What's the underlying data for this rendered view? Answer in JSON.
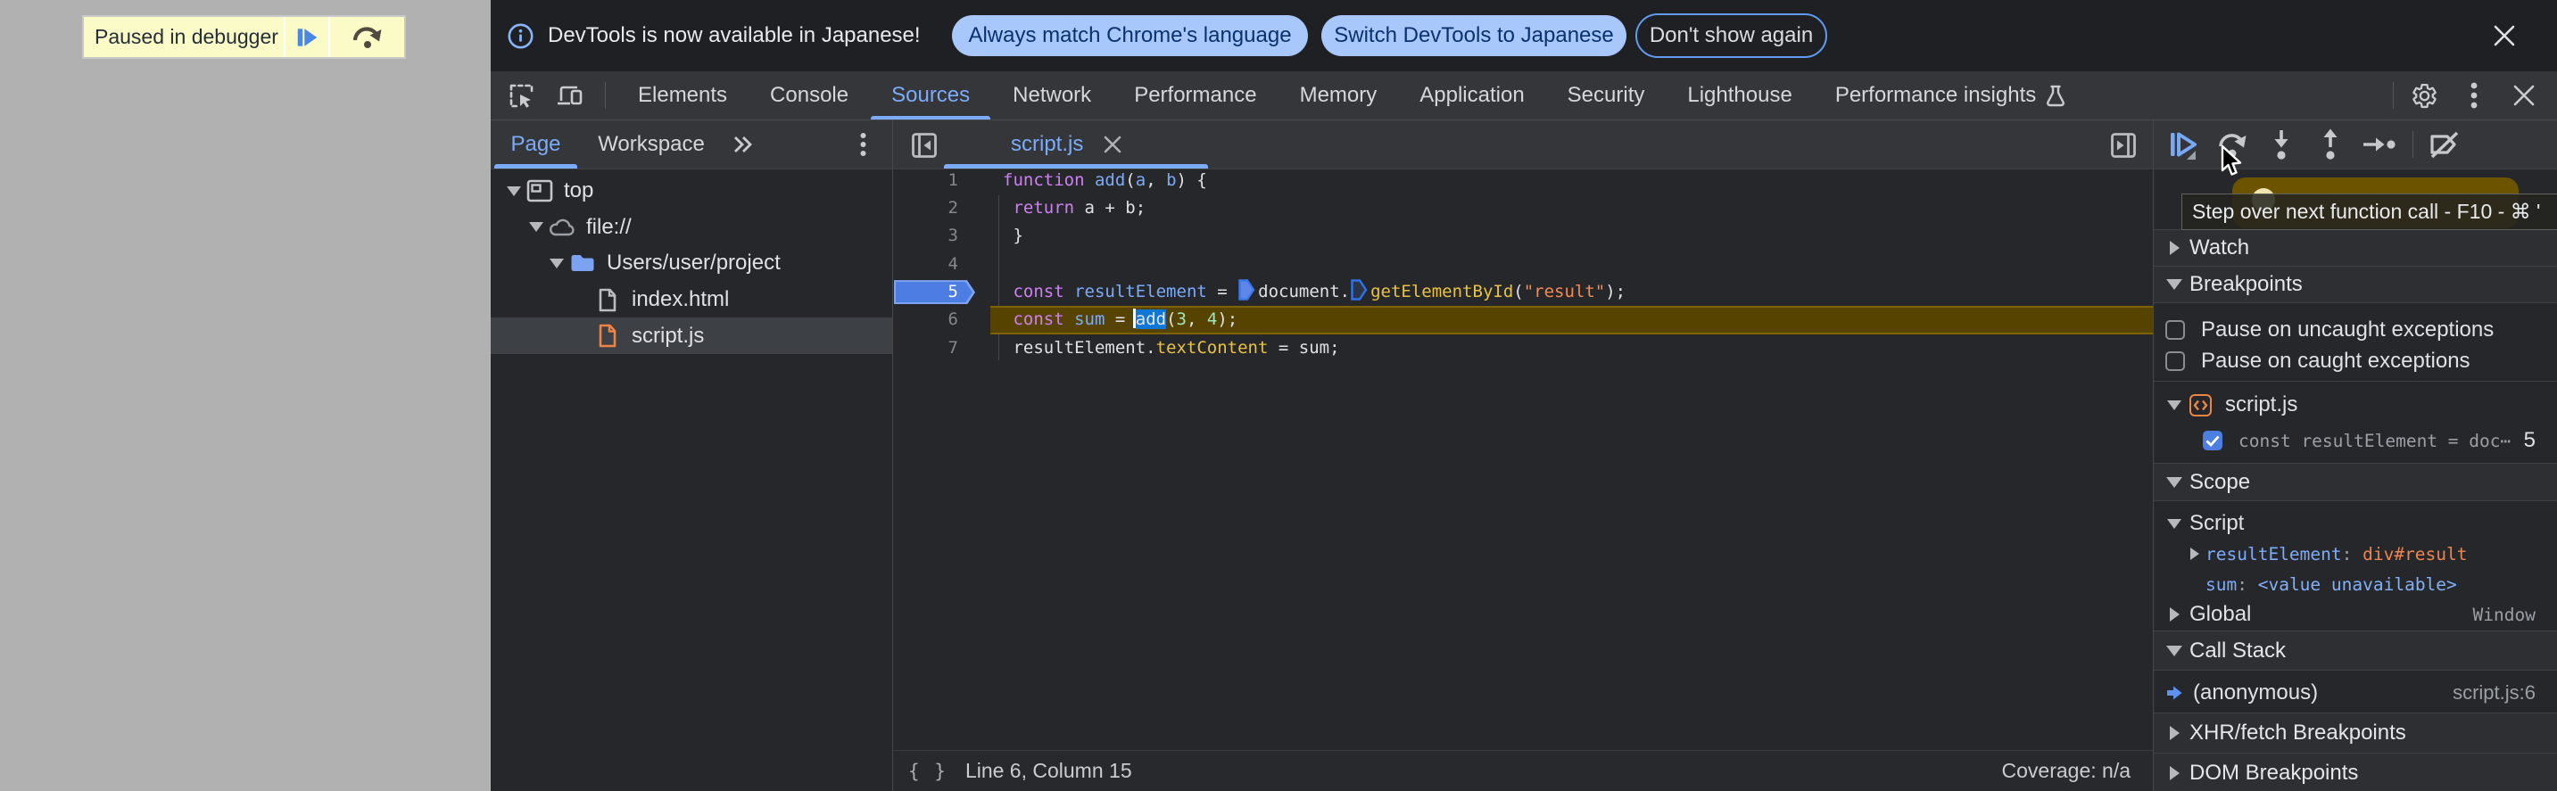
{
  "colors": {
    "accent_blue": "#7cabf8",
    "infobar_pill_bg": "#a8c7fa",
    "selection_blue": "#1177d6",
    "paused_line_bg": "#574300",
    "breakpoint_flag_blue": "#4d7de2",
    "keyword_purple": "#cd80f2",
    "definition_blue": "#7cabf8",
    "property_gold": "#e9c341",
    "string_orange": "#f28b54",
    "number_mint": "#a1e4bd",
    "banner_yellow": "#fbfbc8",
    "page_gray": "#b1b1b1",
    "toolbar_gray": "#343639",
    "panel_dark": "#26272a"
  },
  "page": {
    "banner": {
      "label": "Paused in debugger"
    }
  },
  "infobar": {
    "message": "DevTools is now available in Japanese!",
    "primary_button": "Always match Chrome's language",
    "secondary_button": "Switch DevTools to Japanese",
    "dismiss_button": "Don't show again"
  },
  "tabbar": {
    "selected_tab": "Sources",
    "tabs": [
      {
        "label": "Elements"
      },
      {
        "label": "Console"
      },
      {
        "label": "Sources"
      },
      {
        "label": "Network"
      },
      {
        "label": "Performance"
      },
      {
        "label": "Memory"
      },
      {
        "label": "Application"
      },
      {
        "label": "Security"
      },
      {
        "label": "Lighthouse"
      },
      {
        "label": "Performance insights"
      }
    ]
  },
  "navigator": {
    "tabs": [
      {
        "label": "Page"
      },
      {
        "label": "Workspace"
      }
    ],
    "selected_tab": "Page",
    "tree": [
      {
        "label": "top"
      },
      {
        "label": "file://"
      },
      {
        "label": "Users/user/project"
      },
      {
        "label": "index.html"
      },
      {
        "label": "script.js"
      }
    ],
    "selected_item": "script.js"
  },
  "editor": {
    "tab_label": "script.js",
    "line_numbers": [
      "1",
      "2",
      "3",
      "4",
      "5",
      "6",
      "7"
    ],
    "breakpoint_line": "5",
    "paused_line": "6",
    "code": {
      "l1": [
        {
          "t": "function"
        },
        {
          "t": " "
        },
        {
          "t": "add"
        },
        {
          "t": "("
        },
        {
          "t": "a"
        },
        {
          "t": ", "
        },
        {
          "t": "b"
        },
        {
          "t": ") {"
        }
      ],
      "l2": [
        {
          "t": " "
        },
        {
          "t": "return"
        },
        {
          "t": " a + b;"
        }
      ],
      "l3": [
        {
          "t": " }"
        }
      ],
      "l5": [
        {
          "t": " "
        },
        {
          "t": "const"
        },
        {
          "t": " "
        },
        {
          "t": "resultElement"
        },
        {
          "t": " = "
        },
        {
          "t": "document."
        },
        {
          "t": "getElementById"
        },
        {
          "t": "("
        },
        {
          "t": "\"result\""
        },
        {
          "t": ");"
        }
      ],
      "l6": [
        {
          "t": " "
        },
        {
          "t": "const"
        },
        {
          "t": " "
        },
        {
          "t": "sum"
        },
        {
          "t": " = "
        },
        {
          "t": "add"
        },
        {
          "t": "("
        },
        {
          "t": "3"
        },
        {
          "t": ", "
        },
        {
          "t": "4"
        },
        {
          "t": ");"
        }
      ],
      "l7": [
        {
          "t": " resultElement"
        },
        {
          "t": "."
        },
        {
          "t": "textContent"
        },
        {
          "t": " = sum;"
        }
      ]
    },
    "status": {
      "pretty_print": "{ }",
      "position": "Line 6, Column 15",
      "coverage": "Coverage: n/a"
    }
  },
  "debugger": {
    "tooltip": "Step over next function call - F10 - ⌘ '",
    "watch": {
      "title": "Watch"
    },
    "breakpoints": {
      "title": "Breakpoints",
      "pause_uncaught": "Pause on uncaught exceptions",
      "pause_caught": "Pause on caught exceptions",
      "file": "script.js",
      "entry": "const resultElement = doc⋯",
      "entry_line": "5"
    },
    "scope": {
      "title": "Scope",
      "script_label": "Script",
      "var1_name": "resultElement",
      "var1_sep": ": ",
      "var1_value": "div#result",
      "var2_name": "sum",
      "var2_sep": ": ",
      "var2_value": "<value unavailable>",
      "global_label": "Global",
      "global_value": "Window"
    },
    "call_stack": {
      "title": "Call Stack",
      "frame": "(anonymous)",
      "location": "script.js:6"
    },
    "xhr": {
      "title": "XHR/fetch Breakpoints"
    },
    "dom": {
      "title": "DOM Breakpoints"
    }
  }
}
